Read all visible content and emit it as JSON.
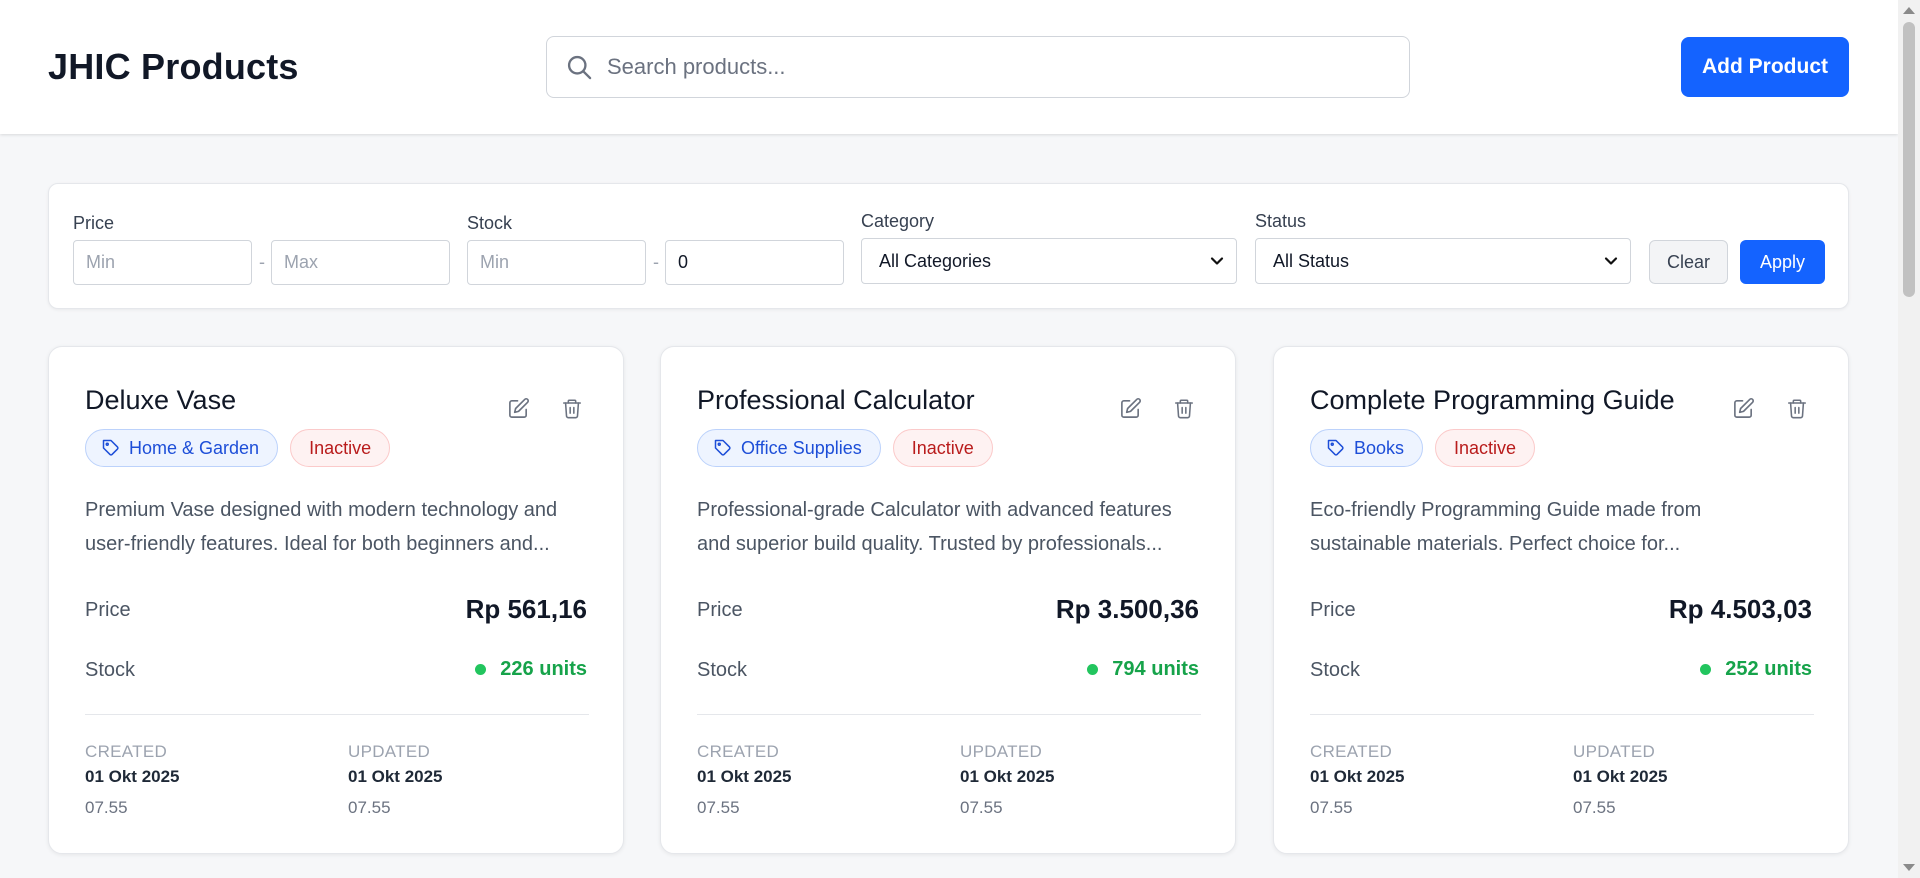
{
  "header": {
    "title": "JHIC Products",
    "search_placeholder": "Search products...",
    "add_button": "Add Product"
  },
  "filters": {
    "price_label": "Price",
    "price_min_placeholder": "Min",
    "price_max_placeholder": "Max",
    "stock_label": "Stock",
    "stock_min_placeholder": "Min",
    "stock_max_value": "0",
    "dash": "-",
    "category_label": "Category",
    "category_selected": "All Categories",
    "status_label": "Status",
    "status_selected": "All Status",
    "clear_button": "Clear",
    "apply_button": "Apply"
  },
  "labels": {
    "price": "Price",
    "stock": "Stock",
    "created": "CREATED",
    "updated": "UPDATED"
  },
  "products": [
    {
      "name": "Deluxe Vase",
      "category": "Home & Garden",
      "status": "Inactive",
      "description_line1": "Premium Vase designed with modern technology and",
      "description_line2": "user-friendly features. Ideal for both beginners and...",
      "price": "Rp 561,16",
      "stock": "226 units",
      "created_date": "01 Okt 2025",
      "created_time": "07.55",
      "updated_date": "01 Okt 2025",
      "updated_time": "07.55"
    },
    {
      "name": "Professional Calculator",
      "category": "Office Supplies",
      "status": "Inactive",
      "description_line1": "Professional-grade Calculator with advanced features",
      "description_line2": "and superior build quality. Trusted by professionals...",
      "price": "Rp 3.500,36",
      "stock": "794 units",
      "created_date": "01 Okt 2025",
      "created_time": "07.55",
      "updated_date": "01 Okt 2025",
      "updated_time": "07.55"
    },
    {
      "name": "Complete Programming Guide",
      "category": "Books",
      "status": "Inactive",
      "description_line1": "Eco-friendly Programming Guide made from",
      "description_line2": "sustainable materials. Perfect choice for...",
      "price": "Rp 4.503,03",
      "stock": "252 units",
      "created_date": "01 Okt 2025",
      "created_time": "07.55",
      "updated_date": "01 Okt 2025",
      "updated_time": "07.55"
    }
  ],
  "colors": {
    "primary": "#1463ff",
    "tag_category_text": "#1d4ed8",
    "tag_inactive_text": "#b91c1c",
    "stock_green": "#16a34a"
  }
}
